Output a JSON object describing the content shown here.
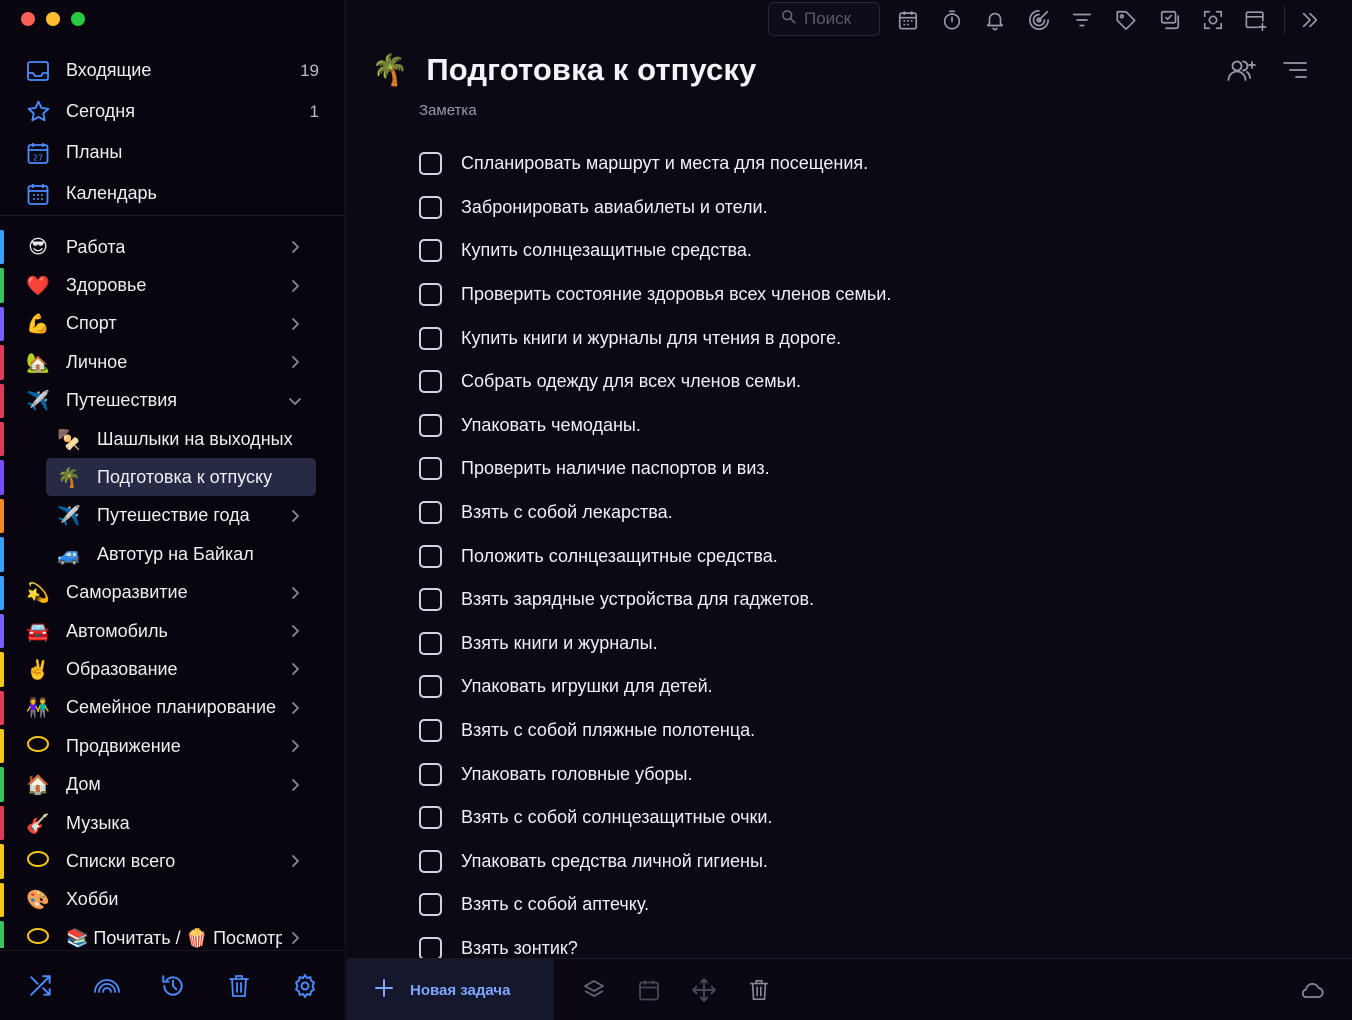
{
  "window": {
    "traffic_colors": [
      "#ff5f57",
      "#febc2e",
      "#28c840"
    ]
  },
  "sidebar": {
    "smart_lists": [
      {
        "label": "Входящие",
        "count": "19",
        "icon": "inbox-icon"
      },
      {
        "label": "Сегодня",
        "count": "1",
        "icon": "star-icon"
      },
      {
        "label": "Планы",
        "count": "",
        "icon": "calendar-27-icon"
      },
      {
        "label": "Календарь",
        "count": "",
        "icon": "calendar-grid-icon"
      }
    ],
    "projects": [
      {
        "emoji": "😎",
        "label": "Работа",
        "bar": "#3aa0ff",
        "chevron": "right"
      },
      {
        "emoji": "❤️",
        "label": "Здоровье",
        "bar": "#3cc060",
        "chevron": "right"
      },
      {
        "emoji": "💪",
        "label": "Спорт",
        "bar": "#7a5cff",
        "chevron": "right"
      },
      {
        "emoji": "🏡",
        "label": "Личное",
        "bar": "#e23a5a",
        "chevron": "right"
      },
      {
        "emoji": "✈️",
        "label": "Путешествия",
        "bar": "#e23a5a",
        "chevron": "down"
      },
      {
        "emoji": "🍢",
        "label": "Шашлыки на выходных",
        "bar": "#e23a5a",
        "chevron": "",
        "sub": true
      },
      {
        "emoji": "🌴",
        "label": "Подготовка к отпуску",
        "bar": "#7b4dff",
        "chevron": "",
        "sub": true,
        "active": true
      },
      {
        "emoji": "✈️",
        "label": "Путешествие года",
        "bar": "#f08a2a",
        "chevron": "right",
        "sub": true
      },
      {
        "emoji": "🚙",
        "label": "Автотур на Байкал",
        "bar": "#3aa0ff",
        "chevron": "",
        "sub": true
      },
      {
        "emoji": "💫",
        "label": "Саморазвитие",
        "bar": "#3aa0ff",
        "chevron": "right"
      },
      {
        "emoji": "🚘",
        "label": "Автомобиль",
        "bar": "#7a5cff",
        "chevron": "right"
      },
      {
        "emoji": "✌️",
        "label": "Образование",
        "bar": "#f5c518",
        "chevron": "right"
      },
      {
        "emoji": "👫",
        "label": "Семейное планирование",
        "bar": "#e23a5a",
        "chevron": "right"
      },
      {
        "emoji": "◯",
        "label": "Продвижение",
        "bar": "#f5c518",
        "chevron": "right",
        "ring": true
      },
      {
        "emoji": "🏠",
        "label": "Дом",
        "bar": "#3cc060",
        "chevron": "right"
      },
      {
        "emoji": "🎸",
        "label": "Музыка",
        "bar": "#e23a5a",
        "chevron": ""
      },
      {
        "emoji": "◯",
        "label": "Списки всего",
        "bar": "#f5c518",
        "chevron": "right",
        "ring": true
      },
      {
        "emoji": "🎨",
        "label": "Хобби",
        "bar": "#f5c518",
        "chevron": ""
      },
      {
        "emoji": "◯",
        "label": "📚 Почитать / 🍿 Посмотреть",
        "bar": "#3cc060",
        "chevron": "right",
        "ring": true
      }
    ],
    "bottom_icons": [
      "shuffle-icon",
      "rainbow-icon",
      "history-icon",
      "trash-icon",
      "gear-icon"
    ]
  },
  "toolbar": {
    "search_placeholder": "Поиск",
    "icons": [
      "calendar-icon",
      "timer-icon",
      "bell-icon",
      "focus-icon",
      "filter-icon",
      "tag-icon",
      "checklist-icon",
      "scan-icon",
      "add-event-icon",
      "expand-icon"
    ]
  },
  "note": {
    "emoji": "🌴",
    "title": "Подготовка к отпуску",
    "subtitle": "Заметка",
    "tasks": [
      "Спланировать маршрут и места для посещения.",
      "Забронировать авиабилеты и отели.",
      "Купить солнцезащитные средства.",
      "Проверить состояние здоровья всех членов семьи.",
      "Купить книги и журналы для чтения в дороге.",
      "Собрать одежду для всех членов семьи.",
      "Упаковать чемоданы.",
      "Проверить наличие паспортов и виз.",
      "Взять с собой лекарства.",
      "Положить солнцезащитные средства.",
      "Взять зарядные устройства для гаджетов.",
      "Взять книги и журналы.",
      "Упаковать игрушки для детей.",
      "Взять с собой пляжные полотенца.",
      "Упаковать головные уборы.",
      "Взять с собой солнцезащитные очки.",
      "Упаковать средства личной гигиены.",
      "Взять с собой аптечку.",
      "Взять зонтик?"
    ]
  },
  "bottom_bar": {
    "new_task_label": "Новая задача",
    "icons": [
      "layers-icon",
      "calendar-icon",
      "move-icon",
      "trash-icon",
      "cloud-icon"
    ]
  }
}
